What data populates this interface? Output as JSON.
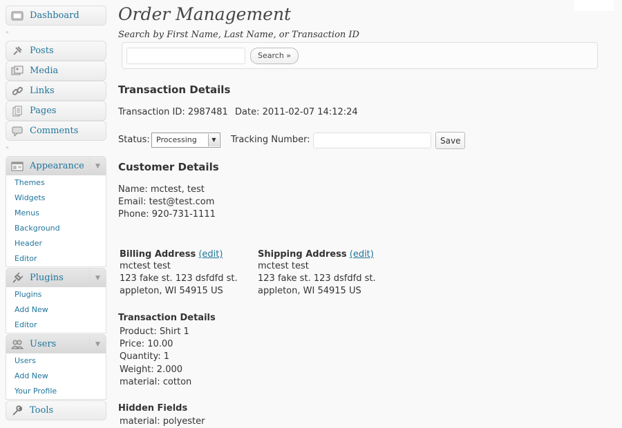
{
  "sidebar": {
    "dashboard": "Dashboard",
    "posts": "Posts",
    "media": "Media",
    "links": "Links",
    "pages": "Pages",
    "comments": "Comments",
    "appearance": {
      "label": "Appearance",
      "items": [
        "Themes",
        "Widgets",
        "Menus",
        "Background",
        "Header",
        "Editor"
      ]
    },
    "plugins": {
      "label": "Plugins",
      "items": [
        "Plugins",
        "Add New",
        "Editor"
      ]
    },
    "users": {
      "label": "Users",
      "items": [
        "Users",
        "Add New",
        "Your Profile"
      ]
    },
    "tools": "Tools"
  },
  "page": {
    "title": "Order Management",
    "search_hint": "Search by First Name, Last Name, or Transaction ID",
    "search_value": "",
    "search_button": "Search »"
  },
  "transaction": {
    "heading": "Transaction Details",
    "id_line": "Transaction ID: 2987481",
    "date_line": "Date: 2011-02-07 14:12:24",
    "status_label": "Status:",
    "status_value": "Processing",
    "tracking_label": "Tracking Number:",
    "tracking_value": "",
    "save_button": "Save"
  },
  "customer": {
    "heading": "Customer Details",
    "name": "Name: mctest, test",
    "email": "Email: test@test.com",
    "phone": "Phone: 920-731-1111"
  },
  "billing": {
    "heading": "Billing Address",
    "edit": "(edit)",
    "lines": [
      "mctest test",
      "123 fake st. 123 dsfdfd st.",
      "appleton, WI 54915 US"
    ]
  },
  "shipping": {
    "heading": "Shipping Address",
    "edit": "(edit)",
    "lines": [
      "mctest test",
      "123 fake st. 123 dsfdfd st.",
      "appleton, WI 54915 US"
    ]
  },
  "details": {
    "heading": "Transaction Details",
    "lines": [
      "Product: Shirt 1",
      "Price: 10.00",
      "Quantity: 1",
      "Weight: 2.000",
      "material: cotton"
    ]
  },
  "hidden": {
    "heading": "Hidden Fields",
    "lines": [
      "material: polyester"
    ]
  }
}
